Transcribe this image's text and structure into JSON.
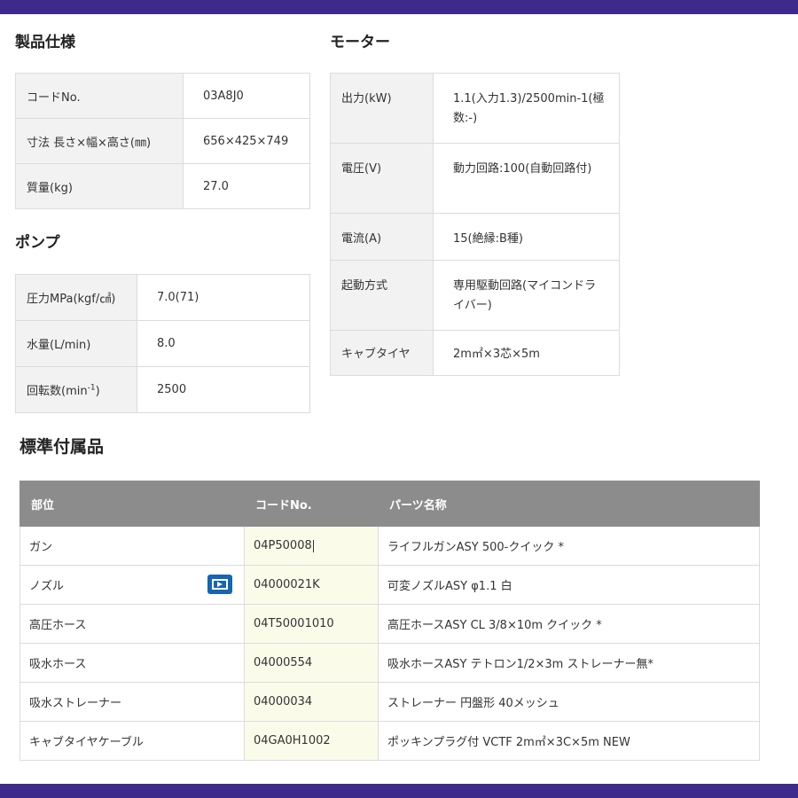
{
  "headings": {
    "spec": "製品仕様",
    "motor": "モーター",
    "pump": "ポンプ",
    "accessories": "標準付属品"
  },
  "spec": [
    {
      "key": "コードNo.",
      "value": "03A8J0"
    },
    {
      "key": "寸法 長さ×幅×高さ(㎜)",
      "value": "656×425×749"
    },
    {
      "key": "質量(kg)",
      "value": "27.0"
    }
  ],
  "pump": [
    {
      "key": "圧力MPa(kgf/㎠)",
      "value": "7.0(71)"
    },
    {
      "key": "水量(L/min)",
      "value": "8.0"
    },
    {
      "key_main": "回転数(min",
      "key_sup": "-1",
      "key_end": ")",
      "value": "2500"
    }
  ],
  "motor": [
    {
      "key": "出力(kW)",
      "value": "1.1(入力1.3)/2500min-1(極数:-)"
    },
    {
      "key": "電圧(V)",
      "value": "動力回路:100(自動回路付)"
    },
    {
      "key": "電流(A)",
      "value": "15(絶縁:B種)"
    },
    {
      "key": "起動方式",
      "value": "専用駆動回路(マイコンドライバー)"
    },
    {
      "key": "キャブタイヤ",
      "value": "2m㎡×3芯×5m"
    }
  ],
  "accessories": {
    "headers": [
      "部位",
      "コードNo.",
      "パーツ名称"
    ],
    "rows": [
      {
        "part": "ガン",
        "code": "04P50008",
        "name": "ライフルガンASY 500-クイック *"
      },
      {
        "part": "ノズル",
        "code": "04000021K",
        "name": "可変ノズルASY φ1.1 白",
        "icon": "video-icon"
      },
      {
        "part": "高圧ホース",
        "code": "04T50001010",
        "name": "高圧ホースASY CL 3/8×10m クイック *"
      },
      {
        "part": "吸水ホース",
        "code": "04000554",
        "name": "吸水ホースASY テトロン1/2×3m ストレーナー無*"
      },
      {
        "part": "吸水ストレーナー",
        "code": "04000034",
        "name": "ストレーナー 円盤形 40メッシュ"
      },
      {
        "part": "キャブタイヤケーブル",
        "code": "04GA0H1002",
        "name": "ポッキンプラグ付 VCTF 2m㎡×3C×5m NEW"
      }
    ]
  },
  "colors": {
    "brand_bar": "#3d2a8c",
    "header_gray": "#8c8c8c",
    "key_cell_bg": "#f2f2f2",
    "code_cell_bg": "#fbfbea",
    "video_icon": "#1565b0"
  }
}
